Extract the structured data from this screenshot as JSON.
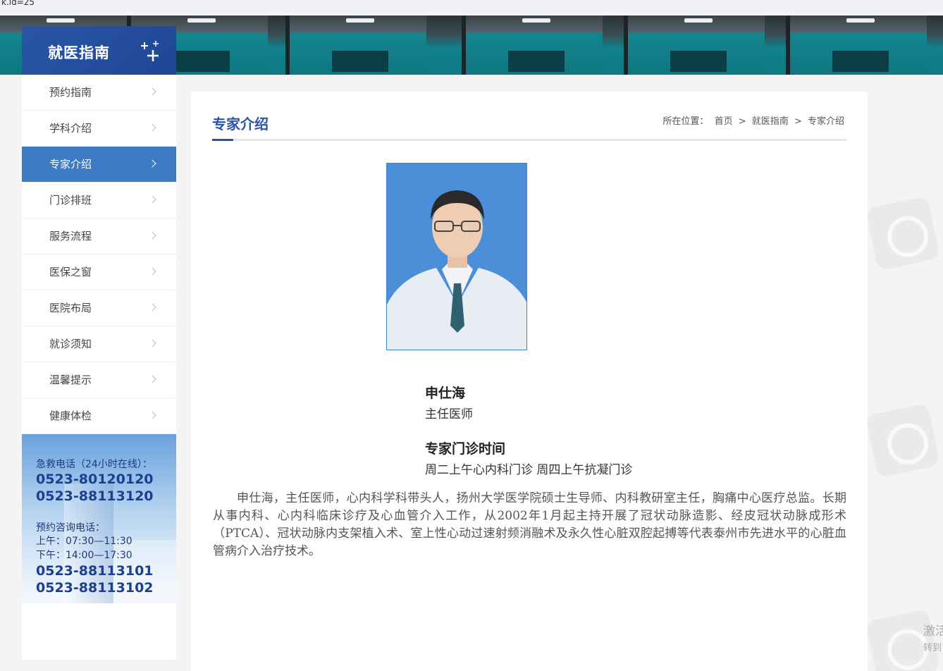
{
  "browser": {
    "url_fragment": "k.id=25"
  },
  "sidebar": {
    "title": "就医指南",
    "items": [
      {
        "label": "预约指南",
        "active": false
      },
      {
        "label": "学科介绍",
        "active": false
      },
      {
        "label": "专家介绍",
        "active": true
      },
      {
        "label": "门诊排班",
        "active": false
      },
      {
        "label": "服务流程",
        "active": false
      },
      {
        "label": "医保之窗",
        "active": false
      },
      {
        "label": "医院布局",
        "active": false
      },
      {
        "label": "就诊须知",
        "active": false
      },
      {
        "label": "温馨提示",
        "active": false
      },
      {
        "label": "健康体检",
        "active": false
      }
    ],
    "contact": {
      "emergency_label": "急救电话（24小时在线）：",
      "emergency_numbers": [
        "0523-80120120",
        "0523-88113120"
      ],
      "booking_label": "预约咨询电话：",
      "morning": "上午：07:30—11:30",
      "afternoon": "下午：14:00—17:30",
      "booking_numbers": [
        "0523-88113101",
        "0523-88113102"
      ]
    }
  },
  "main": {
    "section_title": "专家介绍",
    "breadcrumb": {
      "prefix": "所在位置：",
      "items": [
        "首页",
        "就医指南",
        "专家介绍"
      ],
      "separator": ">"
    },
    "doctor": {
      "name": "申仕海",
      "title": "主任医师",
      "schedule_heading": "专家门诊时间",
      "schedule": "周二上午心内科门诊 周四上午抗凝门诊",
      "bio": "申仕海，主任医师，心内科学科带头人，扬州大学医学院硕士生导师、内科教研室主任，胸痛中心医疗总监。长期从事内科、心内科临床诊疗及心血管介入工作，从2002年1月起主持开展了冠状动脉造影、经皮冠状动脉成形术（PTCA）、冠状动脉内支架植入术、室上性心动过速射频消融术及永久性心脏双腔起搏等代表泰州市先进水平的心脏血管病介入治疗技术。"
    }
  },
  "overlay": {
    "activate_line1": "激活",
    "activate_line2": "转到"
  },
  "colors": {
    "brand_blue": "#2a55a6",
    "active_menu": "#3f7ac4",
    "photo_bg": "#4a8fd8"
  }
}
